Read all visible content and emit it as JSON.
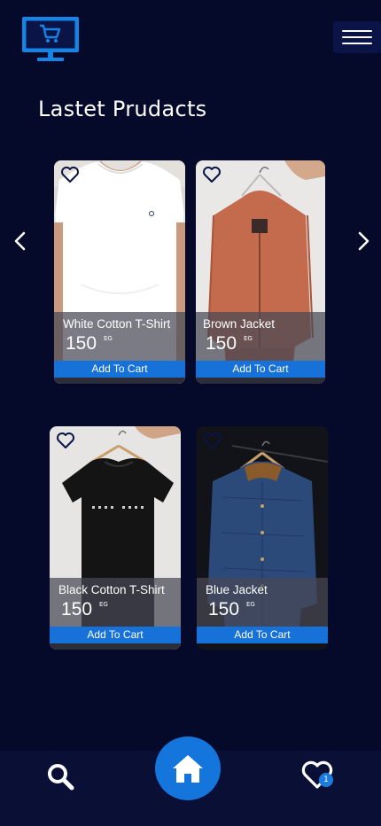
{
  "header": {
    "logo_icon": "cart-monitor-icon",
    "menu_icon": "hamburger-icon"
  },
  "section": {
    "title": "Lastet Prudacts"
  },
  "carousel": {
    "prev_icon": "chevron-left-icon",
    "next_icon": "chevron-right-icon"
  },
  "products": [
    {
      "name": "White Cotton T-Shirt",
      "price": "150",
      "currency": "EG",
      "button": "Add To Cart"
    },
    {
      "name": "Brown Jacket",
      "price": "150",
      "currency": "EG",
      "button": "Add To Cart"
    },
    {
      "name": "Black Cotton T-Shirt",
      "price": "150",
      "currency": "EG",
      "button": "Add To Cart"
    },
    {
      "name": "Blue Jacket",
      "price": "150",
      "currency": "EG",
      "button": "Add To Cart"
    }
  ],
  "bottom_nav": {
    "search_icon": "search-icon",
    "home_icon": "home-icon",
    "favorites_icon": "heart-icon",
    "favorites_count": "1"
  },
  "colors": {
    "background": "#050a2b",
    "accent": "#1671d9"
  }
}
